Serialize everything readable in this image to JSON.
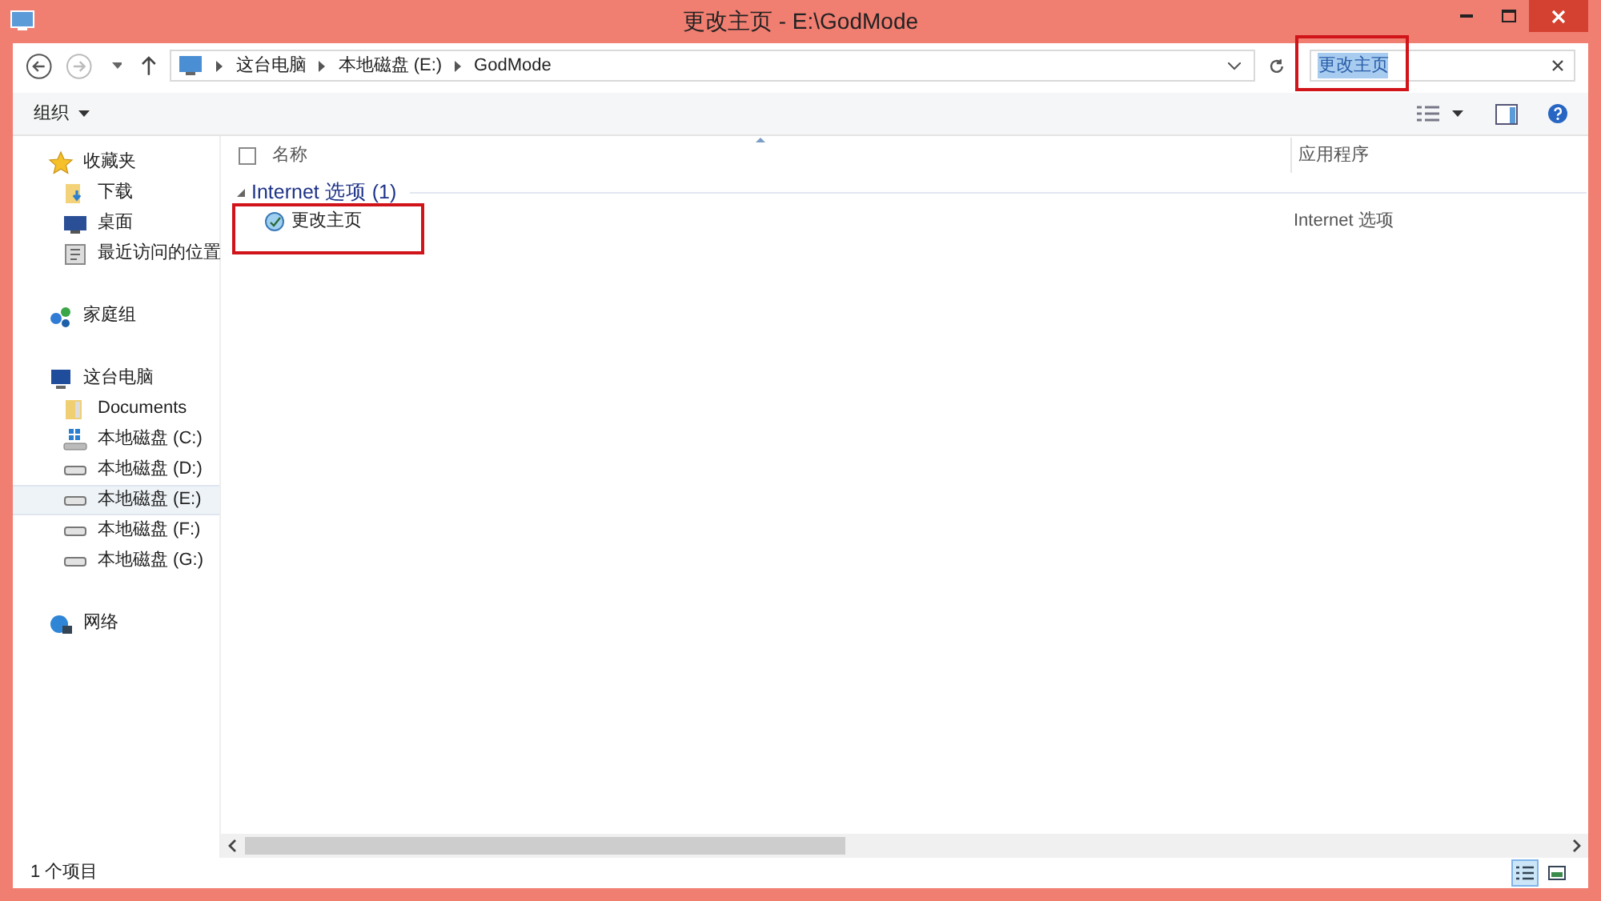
{
  "window": {
    "title": "更改主页 - E:\\GodMode"
  },
  "address": {
    "crumbs": [
      "这台电脑",
      "本地磁盘 (E:)",
      "GodMode"
    ]
  },
  "search": {
    "value": "更改主页",
    "selected": true
  },
  "toolbar": {
    "organize": "组织"
  },
  "sidebar": {
    "items": [
      {
        "label": "收藏夹",
        "kind": "star",
        "selected": false,
        "children": [
          {
            "label": "下载",
            "kind": "download",
            "selected": false
          },
          {
            "label": "桌面",
            "kind": "desktop",
            "selected": false
          },
          {
            "label": "最近访问的位置",
            "kind": "recent",
            "selected": false
          }
        ]
      },
      {
        "label": "家庭组",
        "kind": "homegroup",
        "selected": false
      },
      {
        "label": "这台电脑",
        "kind": "pc",
        "selected": false,
        "children": [
          {
            "label": "Documents",
            "kind": "folder",
            "selected": false
          },
          {
            "label": "本地磁盘 (C:)",
            "kind": "system-drive",
            "selected": false
          },
          {
            "label": "本地磁盘 (D:)",
            "kind": "drive",
            "selected": false
          },
          {
            "label": "本地磁盘 (E:)",
            "kind": "drive",
            "selected": true
          },
          {
            "label": "本地磁盘 (F:)",
            "kind": "drive",
            "selected": false
          },
          {
            "label": "本地磁盘 (G:)",
            "kind": "drive",
            "selected": false
          }
        ]
      },
      {
        "label": "网络",
        "kind": "network",
        "selected": false
      }
    ]
  },
  "table": {
    "select_all_checked": false,
    "columns": [
      "名称",
      "应用程序"
    ],
    "groups": [
      {
        "label": "Internet 选项 (1)",
        "expanded": true,
        "rows": [
          {
            "name": "更改主页",
            "app": "Internet 选项"
          }
        ]
      }
    ]
  },
  "status_bar": {
    "count": "1 个项目",
    "details_view_selected": true
  }
}
